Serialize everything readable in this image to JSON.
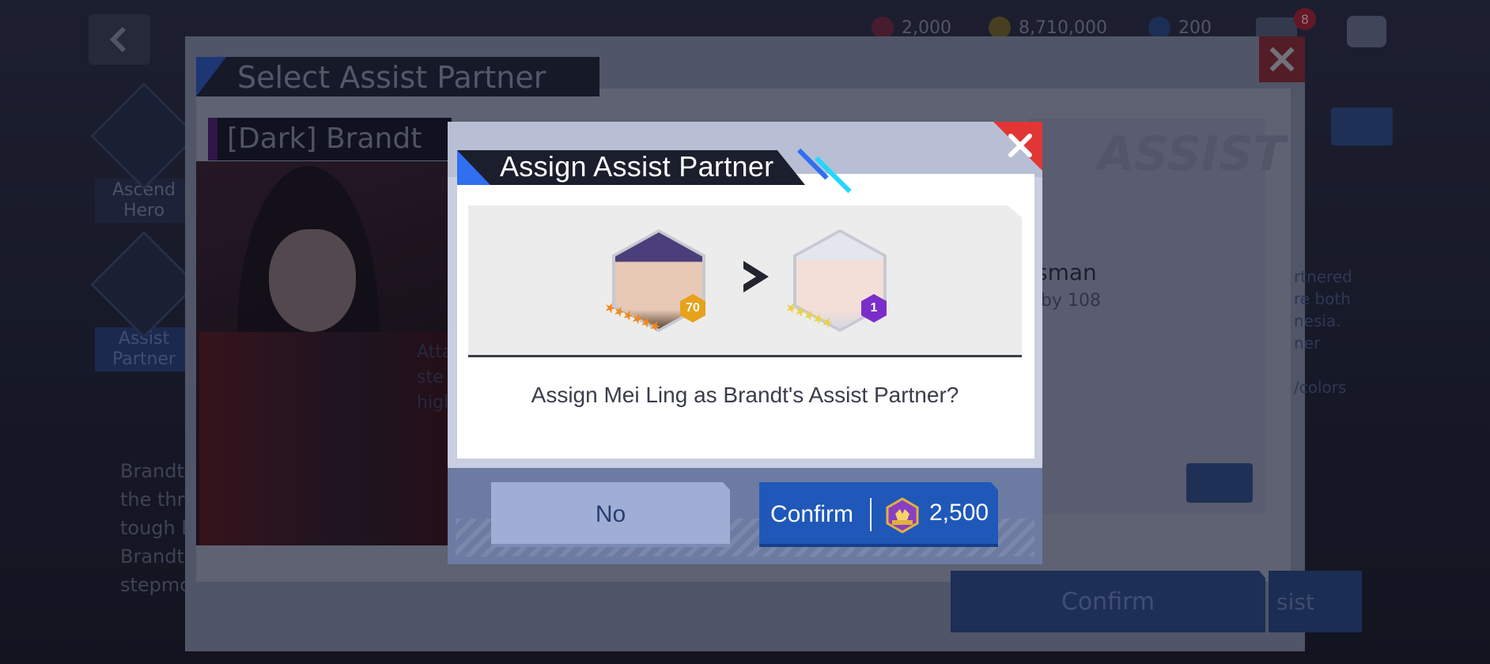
{
  "background": {
    "resources": [
      {
        "name": "gem",
        "value": "2,000",
        "color": "#7a2a44"
      },
      {
        "name": "gold",
        "value": "8,710,000",
        "color": "#7a6a2a"
      },
      {
        "name": "stamina",
        "value": "200",
        "color": "#2a4a8a"
      }
    ],
    "mail_badge": "8",
    "left_nav": [
      {
        "label": "Ascend Hero"
      },
      {
        "label": "Assist Partner"
      }
    ],
    "panel_title": "Select Assist Partner",
    "hero_name": "[Dark] Brandt",
    "desc_fragment": "Atta\nste\nhigh",
    "bottom_fragment": "Brandt\nthe thr\ntough l\nBrandt\nstepmo",
    "right_card": {
      "assist_word": "ASSIST",
      "name_fragment": "sman",
      "sub_fragment": "by 108",
      "side_text": "rtnered\nre both\nnesia.\nner\n\n/colors"
    },
    "big_confirm": "Confirm",
    "side_button": "sist"
  },
  "modal": {
    "title": "Assign Assist Partner",
    "hero_left": {
      "level": "70",
      "stars": "★★★★★★",
      "star_color": "#f08a1c",
      "badge_color": "#e6a21c"
    },
    "hero_right": {
      "level": "1",
      "stars": "★★★★★",
      "star_color": "#e8d34a",
      "badge_color": "#7a2ec8"
    },
    "question": "Assign Mei Ling as Brandt's Assist Partner?",
    "no_label": "No",
    "confirm_label": "Confirm",
    "confirm_cost": "2,500"
  },
  "colors": {
    "accent_blue": "#2f6ff0",
    "close_red": "#e23636",
    "confirm_blue": "#1f58b8",
    "no_blue": "#9eaed5"
  }
}
